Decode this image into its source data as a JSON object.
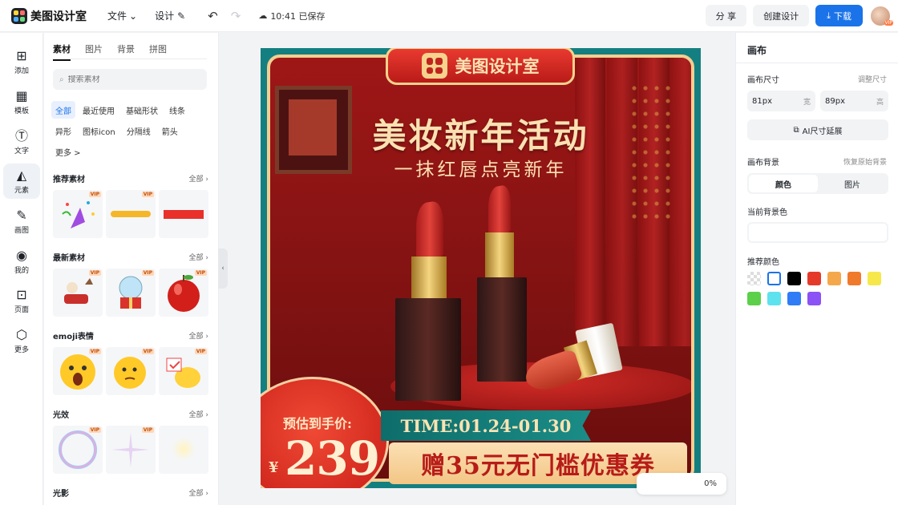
{
  "app": {
    "name": "美图设计室",
    "menu_file": "文件",
    "menu_design": "设计",
    "save_status": "10:41 已保存",
    "share_label": "分 享",
    "create_label": "创建设计",
    "download_label": "下载",
    "avatar_badge": "VIP"
  },
  "rail": {
    "items": [
      {
        "label": "添加",
        "icon": "plus-square-icon"
      },
      {
        "label": "模板",
        "icon": "template-grid-icon"
      },
      {
        "label": "文字",
        "icon": "text-icon"
      },
      {
        "label": "元素",
        "icon": "shapes-icon"
      },
      {
        "label": "画图",
        "icon": "edit-icon"
      },
      {
        "label": "我的",
        "icon": "user-icon"
      },
      {
        "label": "页面",
        "icon": "page-add-icon"
      },
      {
        "label": "更多",
        "icon": "cube-icon"
      }
    ],
    "active": "元素"
  },
  "assets": {
    "tabs": [
      "素材",
      "图片",
      "背景",
      "拼图"
    ],
    "active_tab": "素材",
    "search_placeholder": "搜索素材",
    "chips": [
      "全部",
      "最近使用",
      "基础形状",
      "线条",
      "异形",
      "图标icon",
      "分隔线",
      "箭头",
      "更多 >"
    ],
    "active_chip": "全部",
    "all_label": "全部",
    "vip_label": "VIP",
    "sections": [
      {
        "title": "推荐素材",
        "items": [
          "party-popper",
          "yellow-brush-stroke",
          "red-bar"
        ]
      },
      {
        "title": "最新素材",
        "items": [
          "christmas-sleigh",
          "snow-globe-gift",
          "red-apple"
        ]
      },
      {
        "title": "emoji表情",
        "items": [
          "shocked-emoji",
          "thinking-emoji",
          "chick-emoji"
        ]
      },
      {
        "title": "光效",
        "items": [
          "bubble-ring",
          "sparkle-star",
          "glow-light"
        ]
      },
      {
        "title": "光影",
        "items": []
      }
    ]
  },
  "poster": {
    "brand": "美图设计室",
    "title": "美妆新年活动",
    "subtitle": "一抹红唇点亮新年",
    "price_label": "预估到手价:",
    "currency": "¥",
    "price": "239",
    "time": "TIME:01.24-01.30",
    "coupon": "赠35元无门槛优惠券"
  },
  "zoom": {
    "value": "0%"
  },
  "right_panel": {
    "title": "画布",
    "size_label": "画布尺寸",
    "adjust_size": "调整尺寸",
    "width_value": "81px",
    "width_unit": "宽",
    "height_value": "89px",
    "height_unit": "高",
    "ai_extend": "AI尺寸延展",
    "bg_label": "画布背景",
    "restore_bg": "恢复原始背景",
    "seg_color": "颜色",
    "seg_image": "图片",
    "current_bg": "当前背景色",
    "recommended": "推荐颜色",
    "swatches": [
      "transparent",
      "#ffffff",
      "#000000",
      "#e53a2a",
      "#f5a84b",
      "#f07a2c",
      "#f6e84a",
      "#5ccf4b",
      "#5ee2ee",
      "#2f7cf6",
      "#8b52f5"
    ]
  }
}
